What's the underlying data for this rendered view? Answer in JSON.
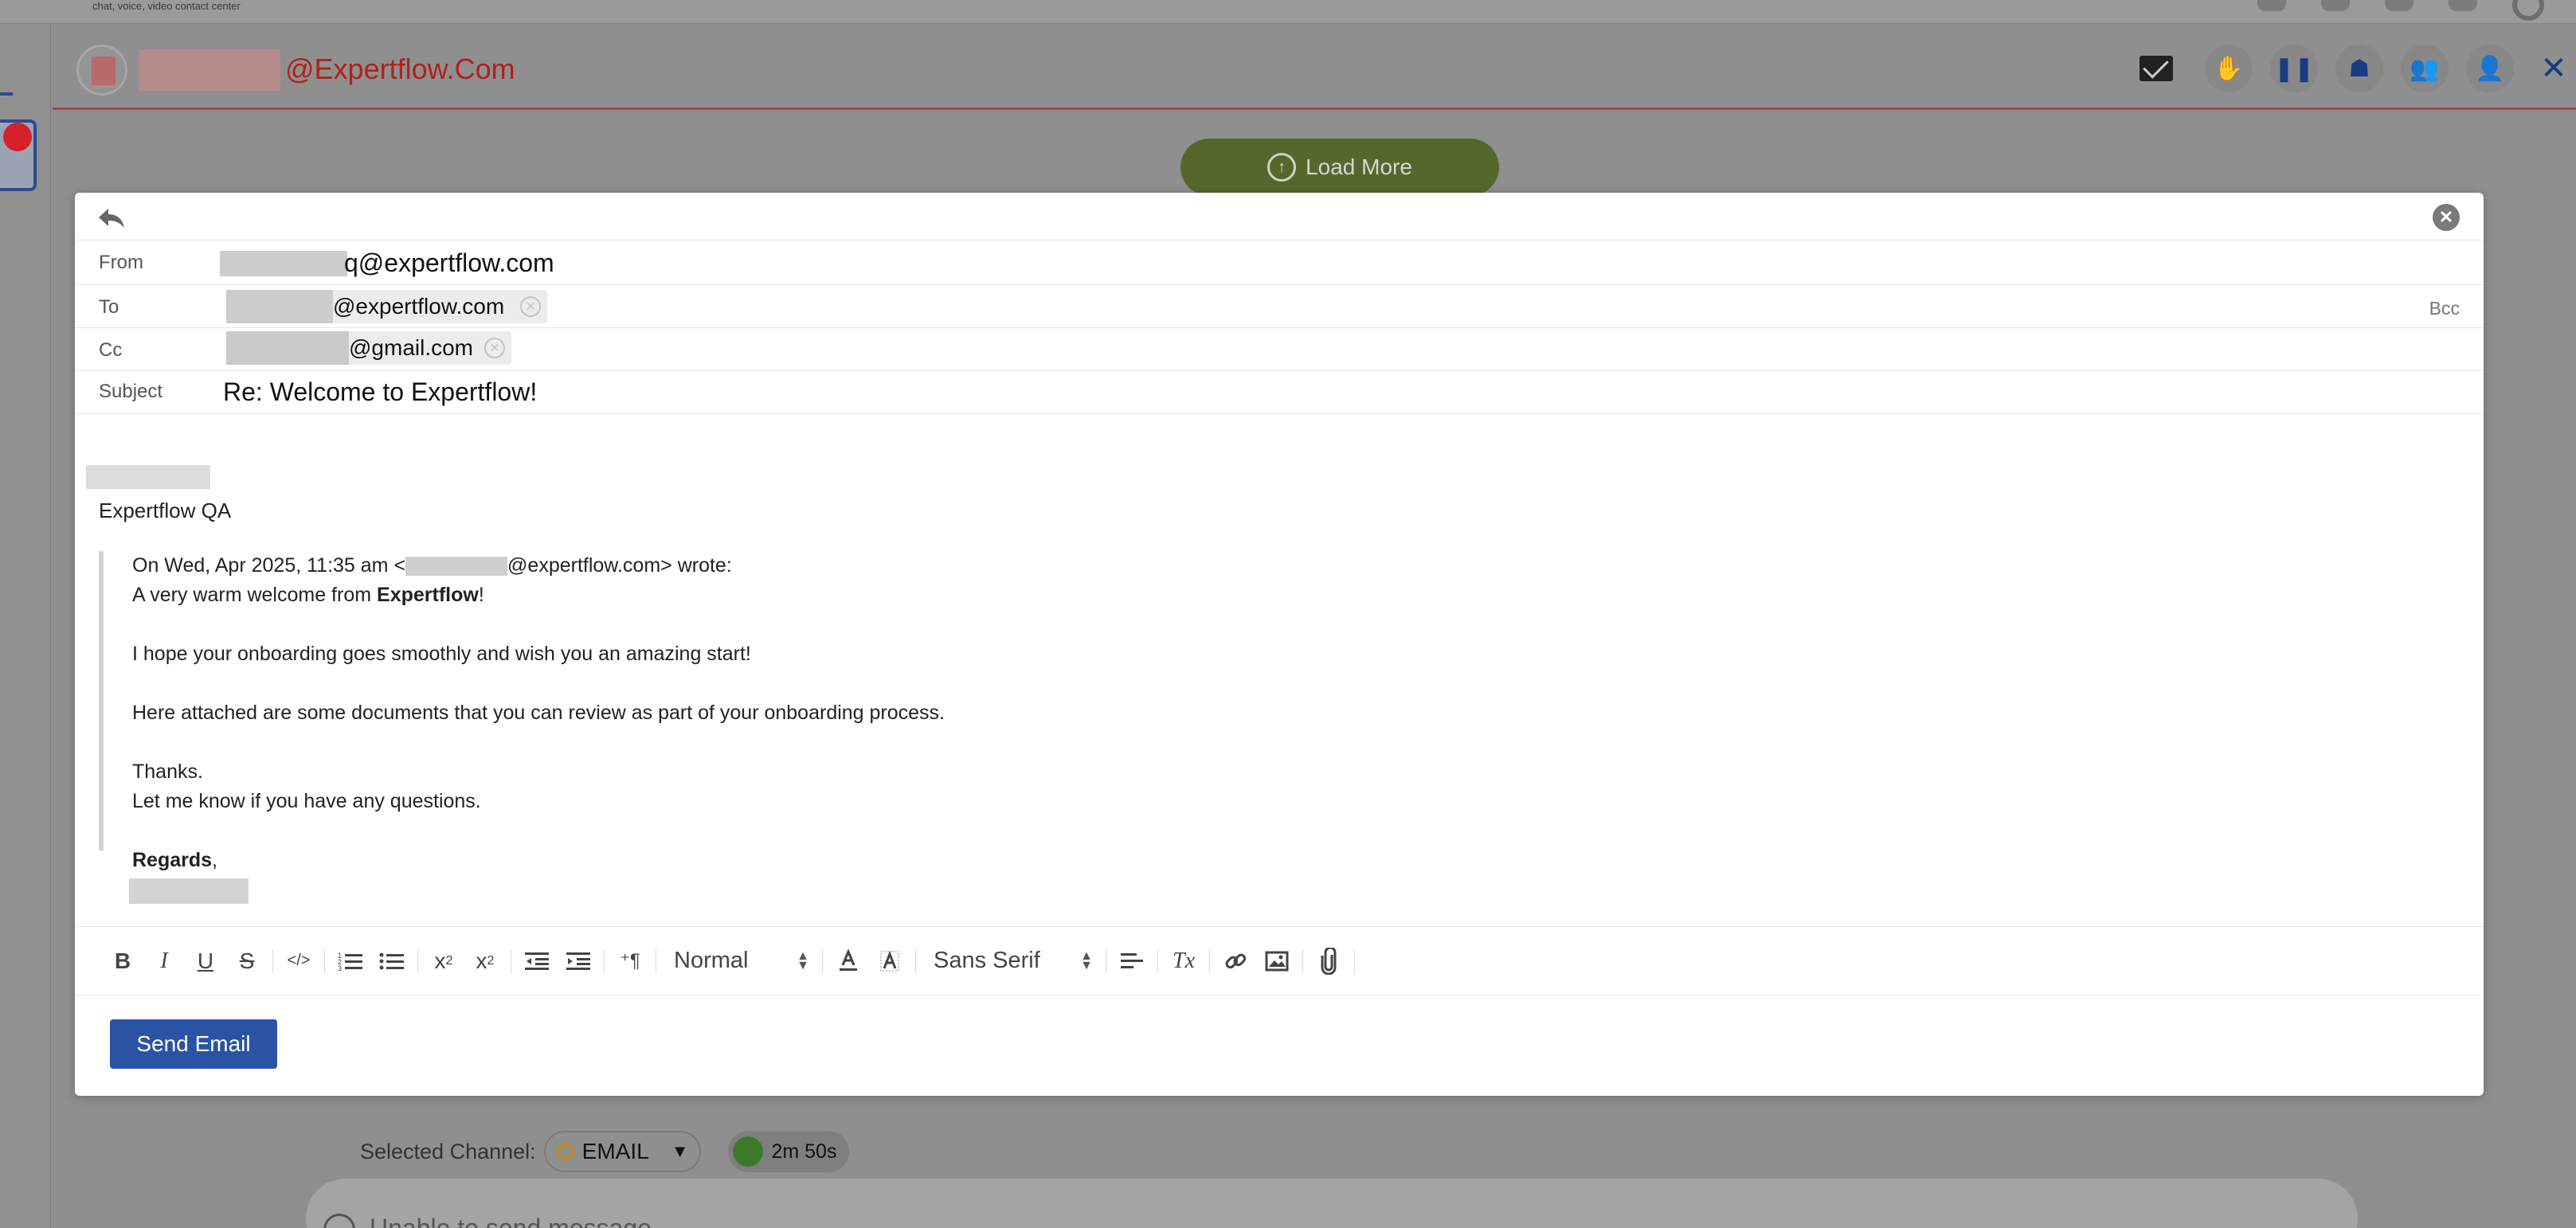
{
  "background": {
    "tagline": "chat, voice, video contact center",
    "header_email": "@Expertflow.Com",
    "load_more_label": "Load More",
    "selected_channel_label": "Selected Channel:",
    "channel_value": "EMAIL",
    "timer": "2m 50s",
    "compose_placeholder": "Unable to send message"
  },
  "composer": {
    "from_label": "From",
    "from_value": "q@expertflow.com",
    "to_label": "To",
    "to_chip": "@expertflow.com",
    "cc_label": "Cc",
    "cc_chip": "@gmail.com",
    "bcc_label": "Bcc",
    "subject_label": "Subject",
    "subject_value": "Re: Welcome to Expertflow!",
    "signature_team": "Expertflow QA",
    "quote": {
      "header_prefix": "On Wed, Apr 2025, 11:35 am <",
      "header_suffix": "@expertflow.com> wrote:",
      "welcome_prefix": "A very warm welcome from ",
      "welcome_bold": "Expertflow",
      "welcome_suffix": "!",
      "line_onboarding": "I hope your onboarding goes smoothly and wish you an amazing start!",
      "line_documents": "Here attached are some documents that you can review as part of your onboarding process.",
      "line_thanks": "Thanks.",
      "line_questions": "Let me know if you have any questions.",
      "regards_bold": "Regards",
      "regards_suffix": ","
    },
    "toolbar": {
      "bold": "B",
      "italic": "I",
      "underline": "U",
      "strike": "S",
      "code": "</>",
      "subscript_base": "x",
      "subscript_mark": "2",
      "superscript_base": "x",
      "superscript_mark": "2",
      "direction": "⁺¶",
      "size_select": "Normal",
      "font_select": "Sans Serif",
      "clear_format": "Tx"
    },
    "send_label": "Send Email"
  },
  "colors": {
    "accent": "#2954a6",
    "header_red": "#b2201d",
    "load_more_green": "#55672a"
  }
}
